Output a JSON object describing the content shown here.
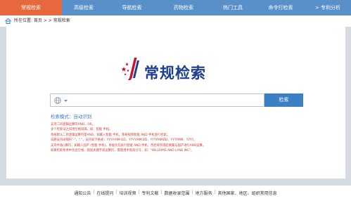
{
  "nav": {
    "items": [
      {
        "label": "常规检索",
        "active": true
      },
      {
        "label": "高级检索",
        "active": false
      },
      {
        "label": "导航检索",
        "active": false
      },
      {
        "label": "药物检索",
        "active": false
      },
      {
        "label": "热门工具",
        "active": false
      },
      {
        "label": "命令行检索",
        "active": false
      },
      {
        "label": "> 专利分析",
        "active": false
      }
    ]
  },
  "breadcrumb": {
    "text": "所在位置: 首页 > > 常规检索"
  },
  "logo": {
    "title": "常规检索"
  },
  "search": {
    "value": "",
    "placeholder": "",
    "button_label": "检索"
  },
  "mode": {
    "text": "检索模式：自动识别"
  },
  "tips": [
    "支持二目逻辑运算符AND、OR。",
    "多个检索词之间用空格间隔，如：智能 手机。",
    "系统默认二目逻辑运算符是AND，如输入智能 手机，系统按照智能 AND 手机进行检索。",
    "日期支持间隔符\"-\"、\".\"，支持如下格式：YYYY-MM-DD、YYYY.MM.DD、YYYYMMDD、YYYYMM、YYYY。",
    "支持半角()算符，如输入国产 (智能 手机)，系统优先执行智能 AND 手机，然后将所得结果集与国产进行AND运算。",
    "如果检索条件中包含空格、保留关键字或运算符，需使用半角双引号，如：\"WILLIAMS AND LANE INC\"。"
  ],
  "footer": {
    "links": [
      "通知公告",
      "在线提问",
      "培训视频",
      "专利文献",
      "数据收录范围",
      "地方服务",
      "其他国家、地区、组织常用信息"
    ]
  },
  "colors": {
    "nav_bg": "#5a90c9",
    "nav_active": "#e8683d",
    "button_bg": "#3b7fc4",
    "tip_text": "#d23c32",
    "logo_text": "#1d3e8c"
  }
}
